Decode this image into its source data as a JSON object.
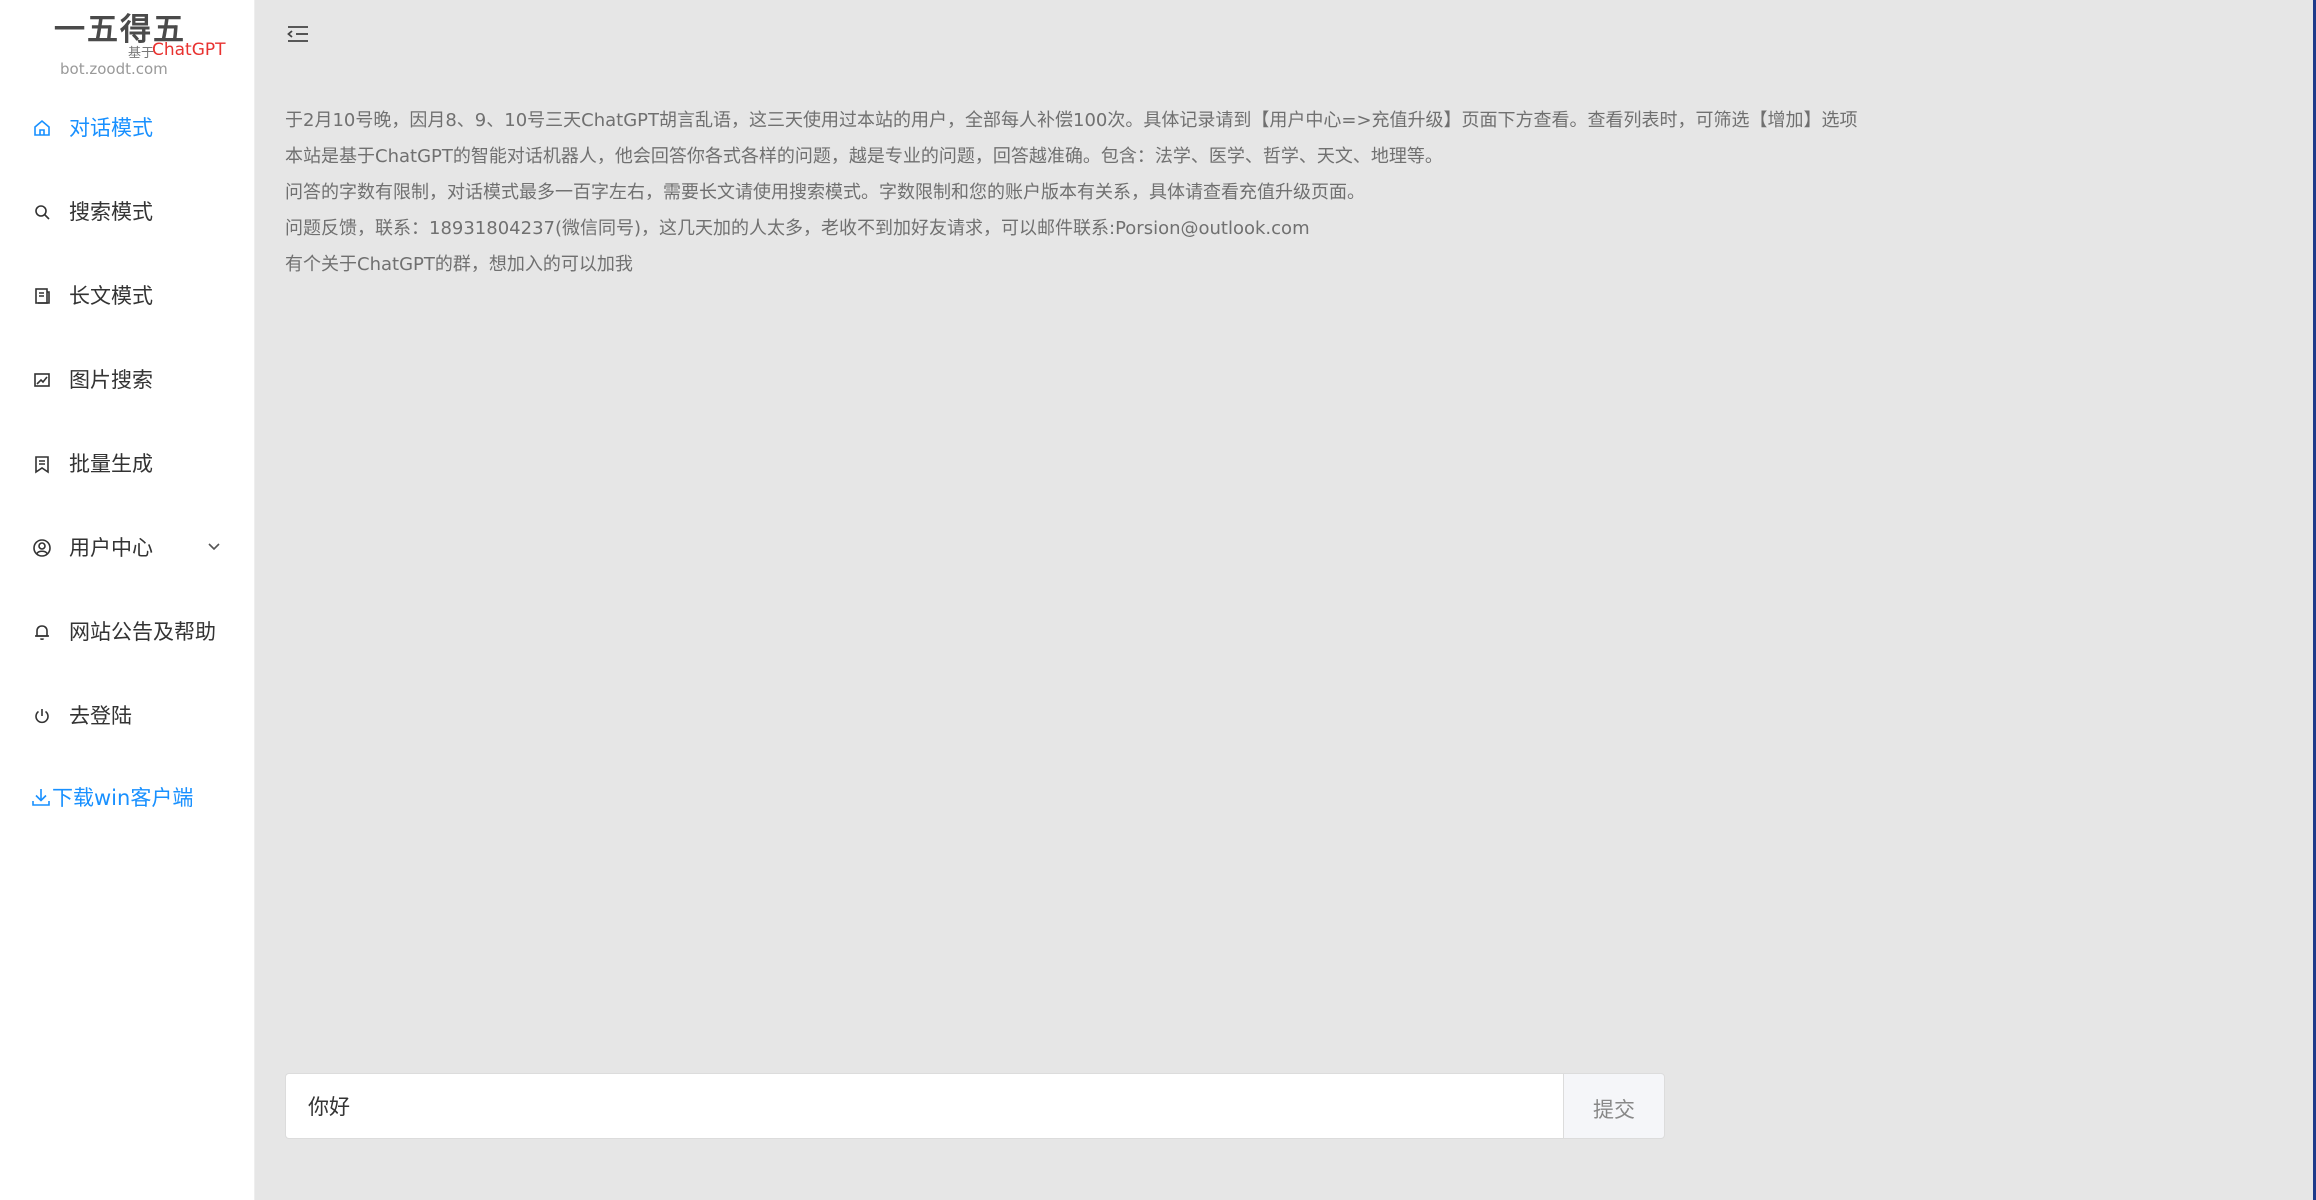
{
  "logo": {
    "title": "一五得五",
    "sub": "基于",
    "brand": "ChatGPT",
    "domain": "bot.zoodt.com"
  },
  "sidebar": {
    "items": [
      {
        "label": "对话模式",
        "icon": "home-icon",
        "active": true
      },
      {
        "label": "搜索模式",
        "icon": "search-icon"
      },
      {
        "label": "长文模式",
        "icon": "document-icon"
      },
      {
        "label": "图片搜索",
        "icon": "image-icon"
      },
      {
        "label": "批量生成",
        "icon": "batch-icon"
      },
      {
        "label": "用户中心",
        "icon": "user-icon",
        "has_submenu": true
      },
      {
        "label": "网站公告及帮助",
        "icon": "bell-icon"
      },
      {
        "label": "去登陆",
        "icon": "power-icon"
      }
    ],
    "download_label": "下载win客户端"
  },
  "notice": {
    "lines": [
      "于2月10号晚，因月8、9、10号三天ChatGPT胡言乱语，这三天使用过本站的用户，全部每人补偿100次。具体记录请到【用户中心=>充值升级】页面下方查看。查看列表时，可筛选【增加】选项",
      "本站是基于ChatGPT的智能对话机器人，他会回答你各式各样的问题，越是专业的问题，回答越准确。包含：法学、医学、哲学、天文、地理等。",
      "问答的字数有限制，对话模式最多一百字左右，需要长文请使用搜索模式。字数限制和您的账户版本有关系，具体请查看充值升级页面。",
      "问题反馈，联系：18931804237(微信同号)，这几天加的人太多，老收不到加好友请求，可以邮件联系:Porsion@outlook.com",
      "有个关于ChatGPT的群，想加入的可以加我"
    ]
  },
  "chat": {
    "input_value": "你好",
    "submit_label": "提交"
  },
  "colors": {
    "accent": "#1890ff",
    "brand_red": "#e8312f",
    "main_bg": "#e6e6e6"
  }
}
